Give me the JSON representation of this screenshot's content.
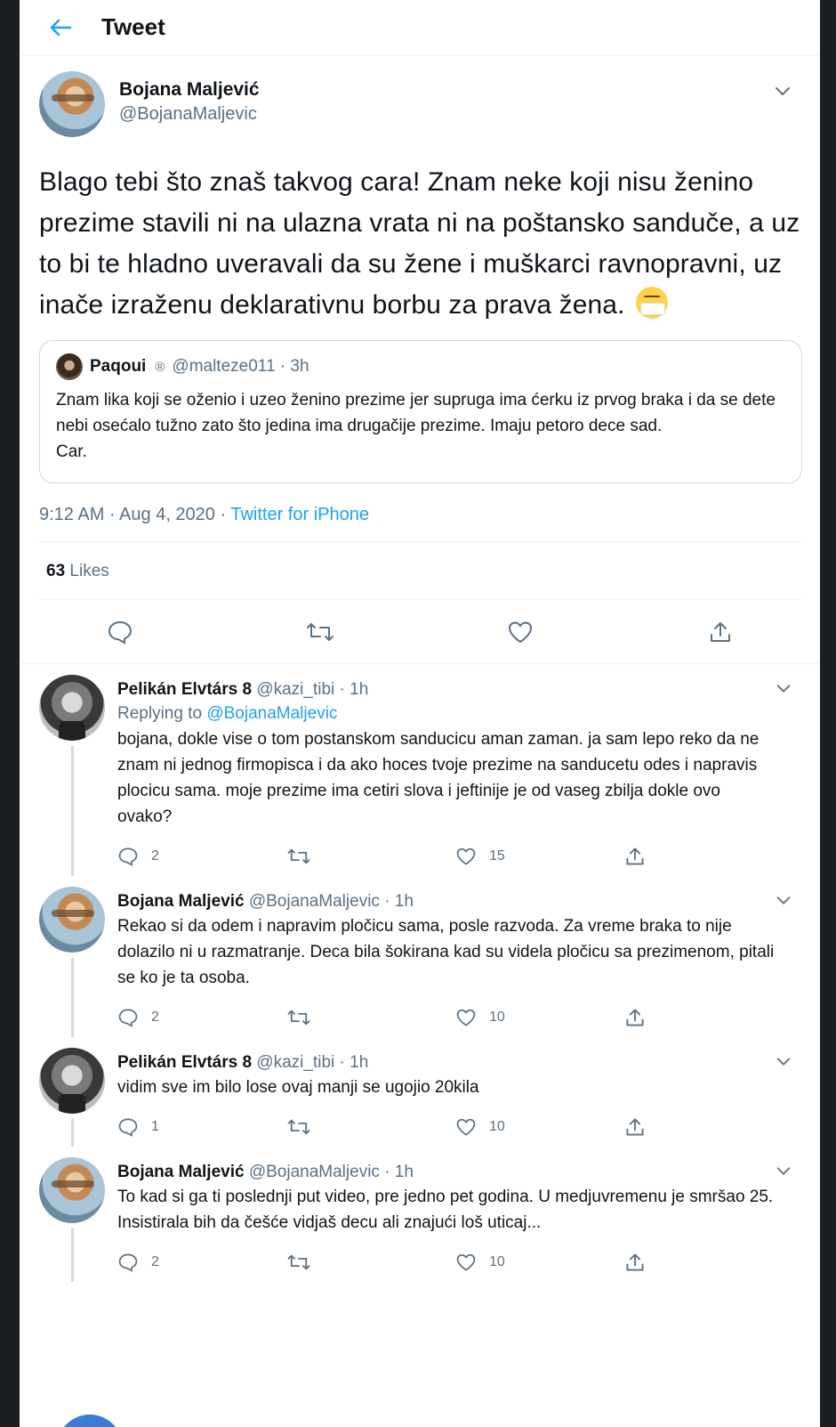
{
  "header": {
    "title": "Tweet"
  },
  "tweet": {
    "author_name": "Bojana Maljević",
    "author_handle": "@BojanaMaljevic",
    "text": "Blago tebi što znaš takvog cara! Znam neke koji nisu ženino prezime stavili ni na ulazna vrata ni na poštansko sandučе, a uz to bi te hladno uveravali da su žene i muškarci ravnopravni, uz inače izraženu deklarativnu borbu za prava žena.",
    "emoji": "face-with-mask-emoji",
    "quote": {
      "author_name": "Paqoui",
      "badge": "®",
      "handle_time": "@malteze011 · 3h",
      "text": "Znam lika koji se oženio i uzeo ženino prezime jer supruga ima ćerku iz prvog braka i da se dete nebi osećalo tužno zato što jedina ima drugačije prezime. Imaju petoro dece sad.",
      "text2": "Car."
    },
    "timestamp": "9:12 AM · Aug 4, 2020 · ",
    "source": "Twitter for iPhone",
    "likes_count": "63",
    "likes_label": "Likes"
  },
  "replies": [
    {
      "name": "Pelikán Elvtárs 8",
      "handle_time": "@kazi_tibi · 1h",
      "replying_prefix": "Replying to ",
      "replying_to": "@BojanaMaljevic",
      "text": "bojana, dokle vise o tom postanskom sanducicu aman zaman. ja sam lepo reko da ne znam ni jednog firmopisca i da ako hoces tvoje prezime na sanducetu odes i napravis plocicu sama. moje prezime ima cetiri slova i jeftinije je od vaseg zbilja dokle ovo ovako?",
      "reply_count": "2",
      "retweet_count": "",
      "like_count": "15"
    },
    {
      "name": "Bojana Maljević",
      "handle_time": "@BojanaMaljevic · 1h",
      "text": "Rekao si da odem i napravim pločicu sama, posle razvoda. Za vreme braka to nije dolazilo ni u razmatranje. Deca bila šokirana kad su videla pločicu sa prezimenom, pitali se ko je ta osoba.",
      "reply_count": "2",
      "retweet_count": "",
      "like_count": "10"
    },
    {
      "name": "Pelikán Elvtárs 8",
      "handle_time": "@kazi_tibi · 1h",
      "text": "vidim sve im bilo lose ovaj manji se ugojio 20kila",
      "reply_count": "1",
      "retweet_count": "",
      "like_count": "10"
    },
    {
      "name": "Bojana Maljević",
      "handle_time": "@BojanaMaljevic · 1h",
      "text": "To kad si ga ti poslednji put video, pre jedno pet godina. U medjuvremenu je smršao 25. Insistirala bih da češće vidjaš decu ali znajući loš uticaj...",
      "reply_count": "2",
      "retweet_count": "",
      "like_count": "10"
    }
  ],
  "colors": {
    "accent": "#1da1f2",
    "secondary_text": "#5b7083",
    "border": "#eef1f3"
  }
}
